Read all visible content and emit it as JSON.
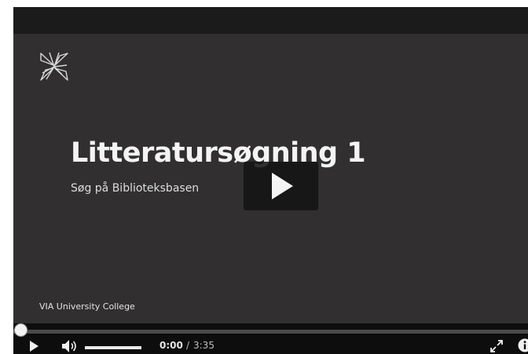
{
  "video": {
    "title": "Litteratursøgning 1",
    "subtitle": "Søg på Biblioteksbasen",
    "organization": "VIA University College",
    "logo_icon": "via-logo-icon"
  },
  "player": {
    "big_play_icon": "play-icon",
    "progress_fraction": 0.0,
    "volume_fraction": 1.0,
    "time_current": "0:00",
    "time_separator": "/",
    "time_total": "3:35",
    "controls": {
      "play_icon": "play-icon",
      "volume_icon": "volume-icon",
      "fullscreen_icon": "fullscreen-icon",
      "info_icon": "info-icon"
    }
  },
  "colors": {
    "background": "#312f30",
    "topbar": "#1b1b1b",
    "controlbar": "#0d0d0d",
    "text": "#f4f4f4"
  }
}
